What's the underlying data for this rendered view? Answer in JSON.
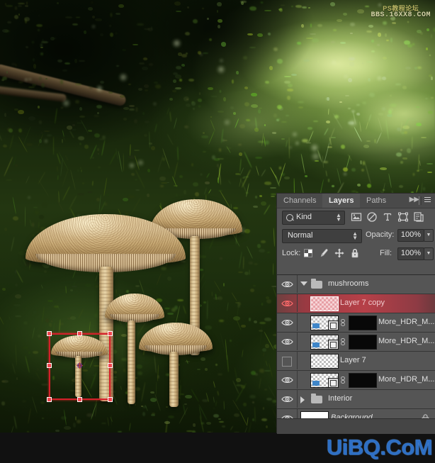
{
  "app": "Adobe Photoshop",
  "photo": {
    "description": "Forest floor scene with parasol mushrooms on green moss",
    "watermark_top_line1": "PS教程论坛",
    "watermark_top_line2": "BBS.16XX8.COM",
    "watermark_bottom": "UiBQ.CoM",
    "watermark_bottom_color": "#2e6fc4"
  },
  "selection": {
    "tool": "free-transform",
    "box_color": "#d3202a",
    "handles": 8,
    "reference_point": "center"
  },
  "panel": {
    "tabs": [
      {
        "label": "Channels",
        "active": false
      },
      {
        "label": "Layers",
        "active": true
      },
      {
        "label": "Paths",
        "active": false
      }
    ],
    "collapse_icon": "▶▶",
    "menu_icon": "panel-menu-icon",
    "filter": {
      "kind_label": "Kind",
      "search_icon": "search-icon",
      "icons": [
        "pixel-layer-filter-icon",
        "adjustment-layer-filter-icon",
        "type-layer-filter-icon",
        "shape-layer-filter-icon",
        "smart-object-filter-icon"
      ]
    },
    "blend_mode": "Normal",
    "opacity_label": "Opacity:",
    "opacity_value": "100%",
    "fill_label": "Fill:",
    "fill_value": "100%",
    "lock_label": "Lock:",
    "lock_icons": [
      "lock-transparent-pixels-icon",
      "lock-image-pixels-icon",
      "lock-position-icon",
      "lock-all-icon"
    ],
    "layers": [
      {
        "name": "mushrooms",
        "type": "group",
        "visible": true,
        "expanded": true,
        "selected": false,
        "indent": 0
      },
      {
        "name": "Layer 7 copy",
        "type": "pixel",
        "visible": true,
        "selected": true,
        "has_mask": false,
        "indent": 1
      },
      {
        "name": "More_HDR_M...",
        "type": "smart-object",
        "visible": true,
        "selected": false,
        "has_mask": true,
        "linked": true,
        "indent": 1
      },
      {
        "name": "More_HDR_M...",
        "type": "smart-object",
        "visible": true,
        "selected": false,
        "has_mask": true,
        "linked": true,
        "indent": 1
      },
      {
        "name": "Layer 7",
        "type": "pixel",
        "visible": false,
        "selected": false,
        "has_mask": false,
        "indent": 1
      },
      {
        "name": "More_HDR_M...",
        "type": "smart-object",
        "visible": true,
        "selected": false,
        "has_mask": true,
        "linked": true,
        "indent": 1
      },
      {
        "name": "Interior",
        "type": "group",
        "visible": true,
        "expanded": false,
        "selected": false,
        "indent": 0
      },
      {
        "name": "Background",
        "type": "background",
        "visible": true,
        "selected": false,
        "locked": true,
        "italic": true,
        "indent": 0
      }
    ]
  }
}
